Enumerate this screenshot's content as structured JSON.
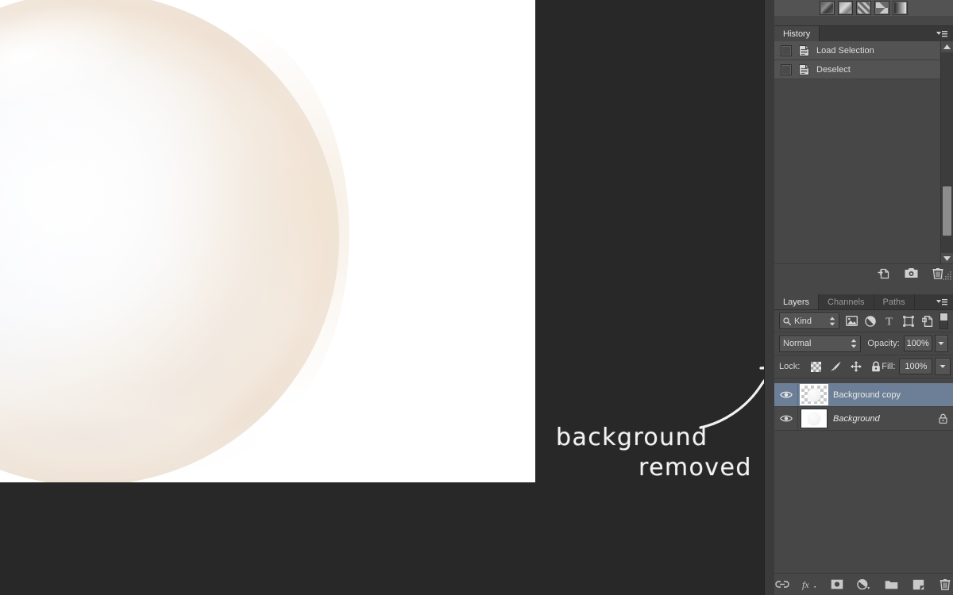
{
  "app": {
    "workspace_bg": "#282828",
    "panel_bg": "#474747",
    "selection_blue": "#6d7f96"
  },
  "canvas": {
    "name": "document-canvas",
    "subject": "white ceramic plate on white background",
    "bg_color": "#ffffff"
  },
  "annotation": {
    "text": "background\nremoved",
    "line1": "background",
    "line2": "removed",
    "color": "#f2f2f2",
    "arrow": "curved-arrow-pointing-up-right"
  },
  "presets": {
    "name": "gradient-preset-strip",
    "swatches": [
      "gradient-swatch-dark-diagonal",
      "gradient-swatch-light-diagonal",
      "gradient-swatch-zigzag",
      "gradient-swatch-bowtie",
      "gradient-swatch-black-to-white"
    ]
  },
  "history": {
    "tab_label": "History",
    "menu_icon": "panel-menu-icon",
    "states": [
      {
        "label": "Load Selection",
        "icon": "history-state-icon",
        "checked": false
      },
      {
        "label": "Deselect",
        "icon": "history-state-icon",
        "checked": false
      }
    ],
    "footer_buttons": [
      {
        "name": "new-document-from-state-button",
        "icon": "new-doc-icon"
      },
      {
        "name": "new-snapshot-button",
        "icon": "camera-icon"
      },
      {
        "name": "delete-state-button",
        "icon": "trash-icon"
      }
    ],
    "scrollbar": {
      "name": "history-scrollbar",
      "up": "▲",
      "down": "▼"
    }
  },
  "layers": {
    "tabs": [
      {
        "label": "Layers",
        "active": true
      },
      {
        "label": "Channels",
        "active": false
      },
      {
        "label": "Paths",
        "active": false
      }
    ],
    "menu_icon": "panel-menu-icon",
    "filter": {
      "label": "Kind",
      "search_icon": "search-icon",
      "stepper_icon": "stepper-arrows-icon",
      "type_buttons": [
        {
          "name": "filter-pixel-layers-button",
          "icon": "image-icon"
        },
        {
          "name": "filter-adjustment-layers-button",
          "icon": "half-circle-icon"
        },
        {
          "name": "filter-type-layers-button",
          "icon": "text-T-icon"
        },
        {
          "name": "filter-shape-layers-button",
          "icon": "shape-bounds-icon"
        },
        {
          "name": "filter-smart-objects-button",
          "icon": "smart-object-icon"
        }
      ],
      "toggle_name": "filter-enable-toggle"
    },
    "blend_mode": "Normal",
    "opacity_label": "Opacity:",
    "opacity_value": "100%",
    "lock_label": "Lock:",
    "lock_buttons": [
      {
        "name": "lock-transparent-pixels-button",
        "icon": "checkerboard-icon"
      },
      {
        "name": "lock-image-pixels-button",
        "icon": "brush-icon"
      },
      {
        "name": "lock-position-button",
        "icon": "move-arrows-icon"
      },
      {
        "name": "lock-all-button",
        "icon": "lock-icon"
      }
    ],
    "fill_label": "Fill:",
    "fill_value": "100%",
    "rows": [
      {
        "name": "Background copy",
        "selected": true,
        "visible": true,
        "italic": false,
        "locked": false,
        "thumbnail": "transparent-checkerboard-with-plate"
      },
      {
        "name": "Background",
        "selected": false,
        "visible": true,
        "italic": true,
        "locked": true,
        "thumbnail": "white-background-with-plate"
      }
    ],
    "footer_buttons": [
      {
        "name": "link-layers-button",
        "icon": "link-icon"
      },
      {
        "name": "layer-style-button",
        "icon": "fx-icon"
      },
      {
        "name": "add-layer-mask-button",
        "icon": "mask-icon"
      },
      {
        "name": "new-adjustment-layer-button",
        "icon": "half-circle-icon"
      },
      {
        "name": "new-group-button",
        "icon": "folder-icon"
      },
      {
        "name": "new-layer-button",
        "icon": "new-layer-icon"
      },
      {
        "name": "delete-layer-button",
        "icon": "trash-icon"
      }
    ]
  }
}
